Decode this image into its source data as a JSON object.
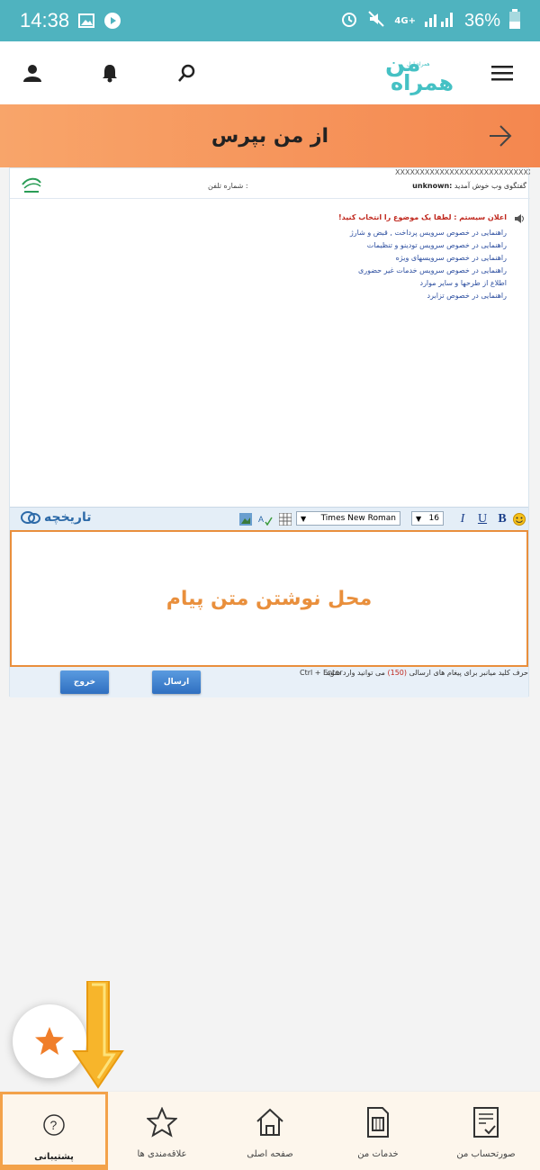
{
  "status_bar": {
    "time": "14:38",
    "network": "4G+",
    "battery": "36%"
  },
  "header": {
    "logo_line1": "من",
    "logo_line2": "همراه",
    "logo_small": "همراه اول"
  },
  "banner": {
    "title": "از من بپرس"
  },
  "chat": {
    "top_xs": "XXXXXXXXXXXXXXXXXXXXXXXXXXXXXXXXX\" >",
    "welcome": "گفتگوی وب  خوش آمدید",
    "user": "unknown:",
    "phone_label": "شماره تلفن :",
    "notice_label": "اعلان سیستم :",
    "notice_text": "لطفا یک موضوع را انتخاب کنید!",
    "options": [
      "راهنمایی در خصوص سرویس پرداخت , قبض و شارژ",
      "راهنمایی در خصوص سرویس تودینو و تنظیمات",
      "راهنمایی در خصوص سرویسهای ویژه",
      "راهنمایی در خصوص سرویس خدمات غیر حضوری",
      "اطلاع از طرحها و سایر موارد",
      "راهنمایی در خصوص تزابرد"
    ],
    "toolbar": {
      "history": "تاریخچه",
      "font_name": "Times New Roman",
      "font_size": "16",
      "bold": "B",
      "underline": "U",
      "italic": "I"
    },
    "editor_placeholder": "محل نوشتن متن پیام",
    "info_prefix": "می توانید وارد شوید",
    "info_count": "(150)",
    "info_suffix": "حرف    کلید میانبر برای پیغام های ارسالی",
    "shortcut": "Ctrl + Enter",
    "send_label": "ارسال",
    "exit_label": "خروج"
  },
  "nav": {
    "items": [
      {
        "label": "صورتحساب من"
      },
      {
        "label": "خدمات من"
      },
      {
        "label": "صفحه اصلی"
      },
      {
        "label": "علاقه‌مندی ها"
      },
      {
        "label": "پشتیبانی"
      }
    ]
  },
  "colors": {
    "teal": "#4fb3bf",
    "orange": "#f4874f",
    "highlight": "#f3a24a"
  }
}
